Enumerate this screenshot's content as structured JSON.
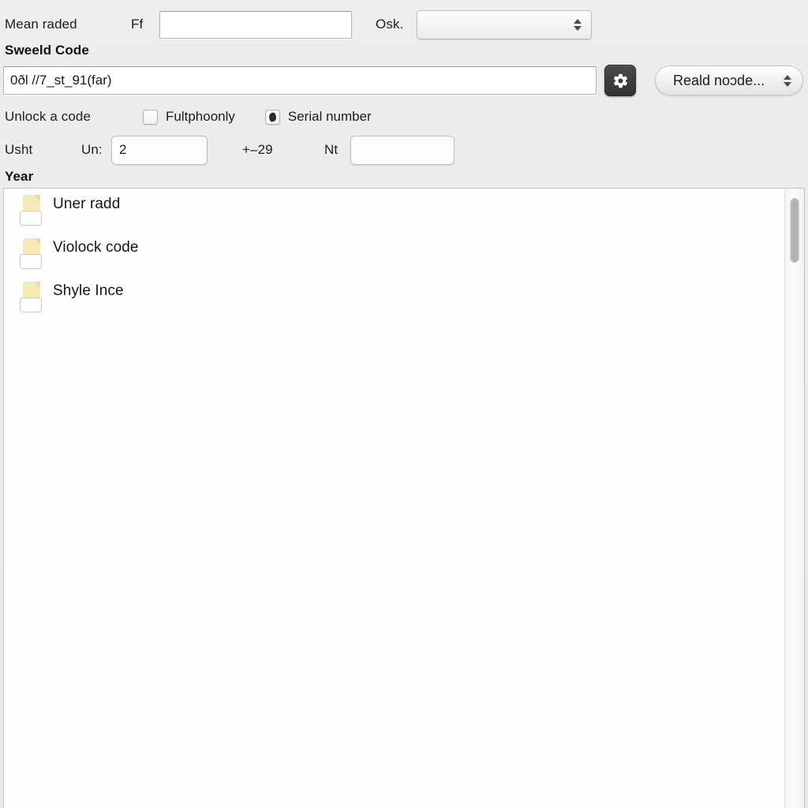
{
  "top_row": {
    "label_left": "Mean raded",
    "label_field": "Ff",
    "field_value": "",
    "field_placeholder": "",
    "label_combo": "Osk.",
    "combo_value": ""
  },
  "code_section": {
    "title": "Sweeld Code",
    "input_value": "0ðl //7_st_91(far)",
    "input_placeholder": "",
    "gear_icon": "gear-icon",
    "popup_label": "Reald noɔde..."
  },
  "checks_row": {
    "label": "Unlock a code",
    "items": [
      {
        "label": "Fultphoonly",
        "checked": false
      },
      {
        "label": "Serial number",
        "checked": true
      }
    ]
  },
  "usht_row": {
    "label": "Usht",
    "un_label": "Un:",
    "un_value": "2",
    "plus_label": "+–29",
    "nt_label": "Nt",
    "nt_value": "",
    "nt_placeholder": ""
  },
  "year_section": {
    "title": "Year",
    "items": [
      {
        "label": "Uner radd",
        "icon": "document-icon"
      },
      {
        "label": "Violock code",
        "icon": "document-icon"
      },
      {
        "label": "Shyle Ince",
        "icon": "document-icon"
      }
    ]
  },
  "colors": {
    "background": "#eaeaea",
    "panel": "#fdfdfd",
    "gear_button": "#3b3b3b",
    "doc_icon": "#f7e9b4",
    "text": "#1c1c1c"
  }
}
